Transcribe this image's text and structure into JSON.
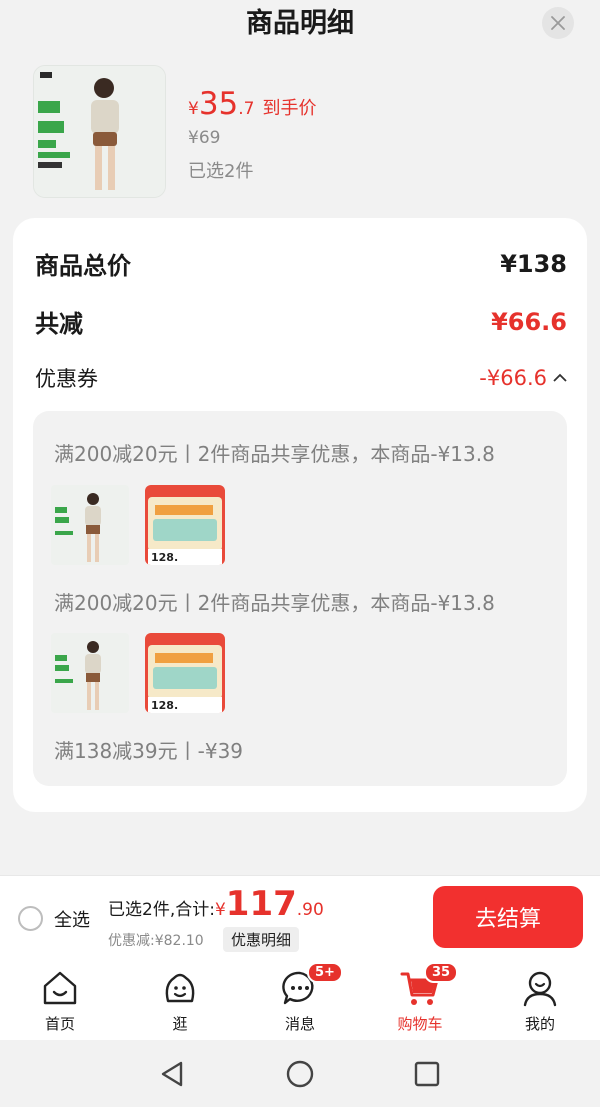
{
  "header": {
    "title": "商品明细"
  },
  "product": {
    "price_symbol": "¥",
    "price_int": "35",
    "price_dec": ".7",
    "price_tag": "到手价",
    "original_price": "¥69",
    "selected": "已选2件"
  },
  "summary": {
    "total_label": "商品总价",
    "total_value": "¥138",
    "reduce_label": "共减",
    "reduce_value": "¥66.6",
    "coupon_label": "优惠券",
    "coupon_value": "-¥66.6"
  },
  "rules": [
    {
      "text": "满200减20元丨2件商品共享优惠，本商品-¥13.8"
    },
    {
      "text": "满200减20元丨2件商品共享优惠，本商品-¥13.8"
    },
    {
      "text": "满138减39元丨-¥39"
    }
  ],
  "thumb_labels": {
    "price": "128."
  },
  "bottom_bar": {
    "select_all": "全选",
    "total_prefix": "已选2件,合计:",
    "total_symbol": "¥",
    "total_int": "117",
    "total_dec": ".90",
    "discount": "优惠减:¥82.10",
    "detail_button": "优惠明细",
    "checkout": "去结算"
  },
  "tabs": [
    {
      "label": "首页",
      "icon": "home-icon"
    },
    {
      "label": "逛",
      "icon": "browse-icon"
    },
    {
      "label": "消息",
      "icon": "message-icon",
      "badge": "5+"
    },
    {
      "label": "购物车",
      "icon": "cart-icon",
      "badge": "35",
      "active": true
    },
    {
      "label": "我的",
      "icon": "profile-icon"
    }
  ],
  "colors": {
    "accent": "#e6322c",
    "checkout": "#f2302f"
  }
}
